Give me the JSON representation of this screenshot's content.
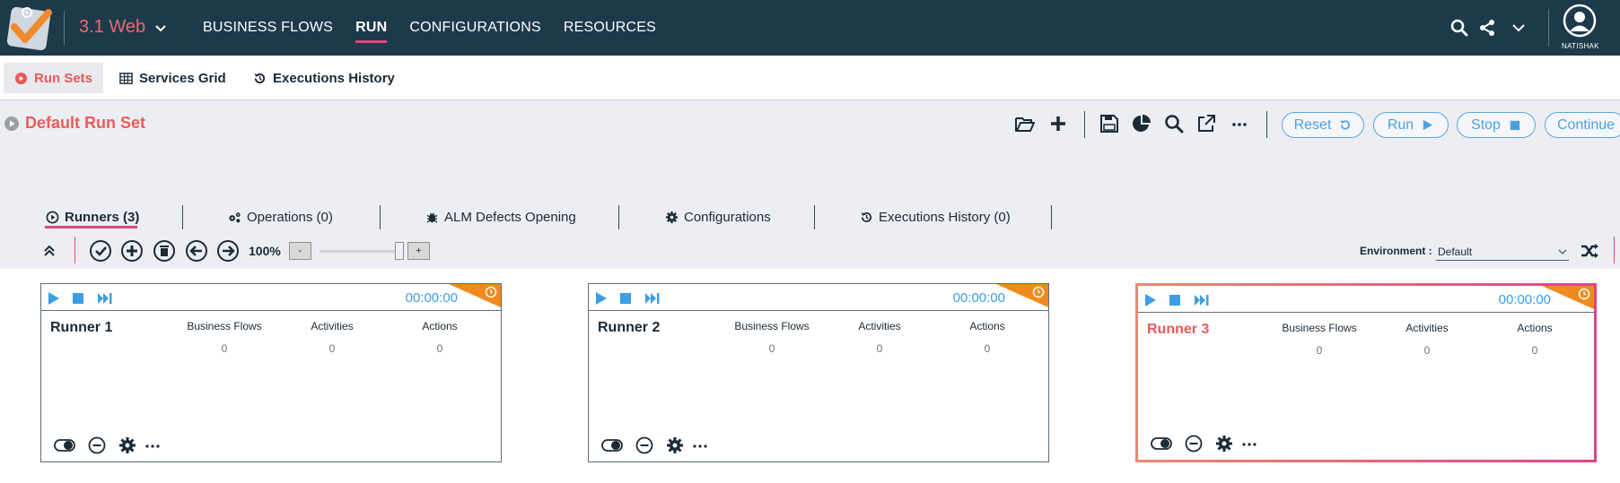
{
  "topbar": {
    "solution_name": "3.1 Web",
    "nav": [
      "BUSINESS FLOWS",
      "RUN",
      "CONFIGURATIONS",
      "RESOURCES"
    ],
    "active_nav": "RUN",
    "username": "NATISHAK",
    "colors": {
      "background": "#1d3a4b",
      "accent": "#e2457a",
      "solution": "#f0676a"
    }
  },
  "subtabs": [
    "Run Sets",
    "Services Grid",
    "Executions History"
  ],
  "runset": {
    "title": "Default Run Set",
    "buttons": {
      "reset": "Reset",
      "run": "Run",
      "stop": "Stop",
      "continue": "Continue"
    }
  },
  "inner_tabs": [
    "Runners (3)",
    "Operations (0)",
    "ALM Defects Opening",
    "Configurations",
    "Executions History (0)"
  ],
  "toolbar": {
    "zoom": "100%",
    "zoom_minus": "-",
    "zoom_plus": "+",
    "environment_label": "Environment :",
    "environment_value": "Default"
  },
  "runner_columns": [
    "Business Flows",
    "Activities",
    "Actions"
  ],
  "runners": [
    {
      "name": "Runner 1",
      "time": "00:00:00",
      "values": [
        "0",
        "0",
        "0"
      ],
      "selected": false
    },
    {
      "name": "Runner 2",
      "time": "00:00:00",
      "values": [
        "0",
        "0",
        "0"
      ],
      "selected": false
    },
    {
      "name": "Runner 3",
      "time": "00:00:00",
      "values": [
        "0",
        "0",
        "0"
      ],
      "selected": true
    }
  ],
  "icons": {
    "toolbar": [
      "folder-open-icon",
      "plus-icon",
      "save-icon",
      "pie-chart-icon",
      "search-icon",
      "external-link-icon",
      "more-icon"
    ],
    "runner_controls": [
      "collapse-icon",
      "check-icon",
      "add-icon",
      "delete-icon",
      "arrow-left-icon",
      "arrow-right-icon"
    ]
  }
}
